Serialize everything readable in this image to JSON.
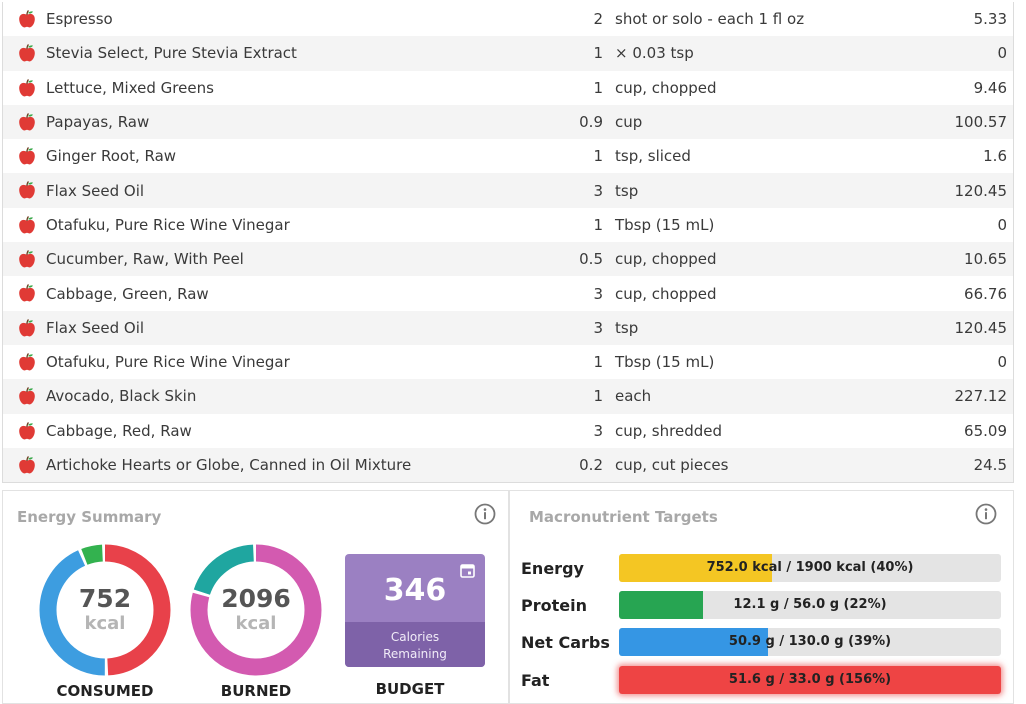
{
  "foods": [
    {
      "name": "Espresso",
      "qty": "2",
      "unit": "shot or solo - each 1 fl oz",
      "kcal": "5.33"
    },
    {
      "name": "Stevia Select, Pure Stevia Extract",
      "qty": "1",
      "unit": "× 0.03 tsp",
      "kcal": "0"
    },
    {
      "name": "Lettuce, Mixed Greens",
      "qty": "1",
      "unit": "cup, chopped",
      "kcal": "9.46"
    },
    {
      "name": "Papayas, Raw",
      "qty": "0.9",
      "unit": "cup",
      "kcal": "100.57"
    },
    {
      "name": "Ginger Root, Raw",
      "qty": "1",
      "unit": "tsp, sliced",
      "kcal": "1.6"
    },
    {
      "name": "Flax Seed Oil",
      "qty": "3",
      "unit": "tsp",
      "kcal": "120.45"
    },
    {
      "name": "Otafuku, Pure Rice Wine Vinegar",
      "qty": "1",
      "unit": "Tbsp (15 mL)",
      "kcal": "0"
    },
    {
      "name": "Cucumber, Raw, With Peel",
      "qty": "0.5",
      "unit": "cup, chopped",
      "kcal": "10.65"
    },
    {
      "name": "Cabbage, Green, Raw",
      "qty": "3",
      "unit": "cup, chopped",
      "kcal": "66.76"
    },
    {
      "name": "Flax Seed Oil",
      "qty": "3",
      "unit": "tsp",
      "kcal": "120.45"
    },
    {
      "name": "Otafuku, Pure Rice Wine Vinegar",
      "qty": "1",
      "unit": "Tbsp (15 mL)",
      "kcal": "0"
    },
    {
      "name": "Avocado, Black Skin",
      "qty": "1",
      "unit": "each",
      "kcal": "227.12"
    },
    {
      "name": "Cabbage, Red, Raw",
      "qty": "3",
      "unit": "cup, shredded",
      "kcal": "65.09"
    },
    {
      "name": "Artichoke Hearts or Globe, Canned in Oil Mixture",
      "qty": "0.2",
      "unit": "cup, cut pieces",
      "kcal": "24.5"
    }
  ],
  "food_icon": "apple-icon",
  "energy_summary": {
    "title": "Energy Summary",
    "info_icon": "info-icon",
    "consumed": {
      "value": "752",
      "unit": "kcal",
      "label": "CONSUMED",
      "segments": [
        {
          "color": "#e8414a",
          "fraction": 0.5
        },
        {
          "color": "#3d9de0",
          "fraction": 0.44
        },
        {
          "color": "#33b24f",
          "fraction": 0.06
        }
      ]
    },
    "burned": {
      "value": "2096",
      "unit": "kcal",
      "label": "BURNED",
      "segments": [
        {
          "color": "#d35ab0",
          "fraction": 0.8
        },
        {
          "color": "#1fa6a0",
          "fraction": 0.2
        }
      ]
    },
    "budget": {
      "value": "346",
      "line1": "Calories",
      "line2": "Remaining",
      "label": "BUDGET",
      "icon": "calendar-icon"
    }
  },
  "macro_targets": {
    "title": "Macronutrient Targets",
    "info_icon": "info-icon",
    "rows": [
      {
        "label": "Energy",
        "text": "752.0 kcal / 1900 kcal (40%)",
        "fraction": 0.4,
        "color": "#f4c623"
      },
      {
        "label": "Protein",
        "text": "12.1 g / 56.0 g (22%)",
        "fraction": 0.22,
        "color": "#27a552"
      },
      {
        "label": "Net Carbs",
        "text": "50.9 g / 130.0 g (39%)",
        "fraction": 0.39,
        "color": "#3596e4"
      },
      {
        "label": "Fat",
        "text": "51.6 g / 33.0 g (156%)",
        "fraction": 1.0,
        "color": "#ee4444",
        "over": true
      }
    ]
  }
}
